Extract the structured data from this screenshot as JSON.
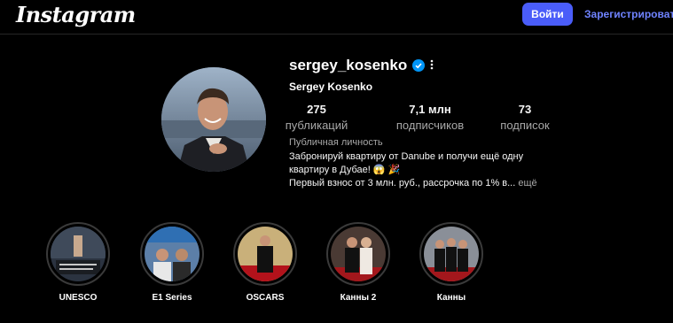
{
  "header": {
    "logo_text": "Instagram",
    "login_label": "Войти",
    "register_label": "Зарегистрироваться"
  },
  "profile": {
    "username": "sergey_kosenko",
    "full_name": "Sergey Kosenko",
    "verified": true,
    "stats": [
      {
        "value": "275",
        "label": "публикаций"
      },
      {
        "value": "7,1 млн",
        "label": "подписчиков"
      },
      {
        "value": "73",
        "label": "подписок"
      }
    ],
    "category": "Публичная личность",
    "bio_line1": "Забронируй квартиру от Danube и получи ещё одну",
    "bio_line2": "квартиру в Дубае! 😱 🎉",
    "bio_line3": "Первый взнос от 3 млн. руб., рассрочка по 1% в...",
    "bio_more": "ещё"
  },
  "highlights": [
    {
      "label": "UNESCO"
    },
    {
      "label": "E1 Series"
    },
    {
      "label": "OSCARS"
    },
    {
      "label": "Канны 2"
    },
    {
      "label": "Канны"
    }
  ],
  "colors": {
    "background": "#000000",
    "accent": "#4a5df9",
    "link": "#6f83ff",
    "verified": "#0095f6"
  }
}
